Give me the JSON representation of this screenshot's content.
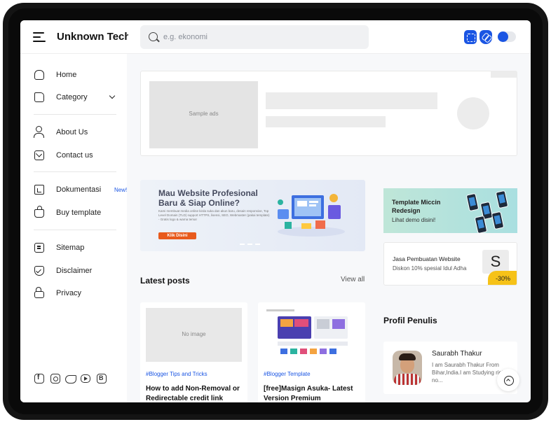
{
  "header": {
    "site_title": "Unknown Tech",
    "search_placeholder": "e.g. ekonomi"
  },
  "sidebar": {
    "items": [
      {
        "label": "Home",
        "icon": "home-icon"
      },
      {
        "label": "Category",
        "icon": "folder-icon"
      },
      {
        "label": "About Us",
        "icon": "user-icon"
      },
      {
        "label": "Contact us",
        "icon": "mail-icon"
      },
      {
        "label": "Dokumentasi",
        "icon": "document-icon",
        "badge": "New!"
      },
      {
        "label": "Buy template",
        "icon": "shopping-bag-icon"
      },
      {
        "label": "Sitemap",
        "icon": "sitemap-icon"
      },
      {
        "label": "Disclaimer",
        "icon": "shield-icon"
      },
      {
        "label": "Privacy",
        "icon": "lock-icon"
      }
    ],
    "social": [
      "facebook-icon",
      "instagram-icon",
      "twitter-icon",
      "youtube-icon",
      "blogger-icon"
    ]
  },
  "ad": {
    "placeholder": "Sample ads"
  },
  "banner": {
    "title": "Mau Website Profesional Baru & Siap Online?",
    "subtitle": "Kami membuat media online kirda suka dan akun baru, desain responsive, Top Level Domain (TLD) support HTTPS, lisensi, SEO, Webmaster (pakai template) - Gratis logo & warna tema!",
    "cta": "Klik Disini"
  },
  "promos": [
    {
      "title": "Template Miccin Redesign",
      "subtitle": "Lihat demo disini!"
    },
    {
      "title": "Jasa Pembuatan Website",
      "subtitle": "Diskon 10% spesial Idul Adha",
      "logo": "S",
      "discount": "-30%"
    }
  ],
  "latest": {
    "title": "Latest posts",
    "view_all": "View all",
    "posts": [
      {
        "thumb": "No image",
        "tag": "#Blogger Tips and Tricks",
        "title": "How to add Non-Removal or Redirectable credit link"
      },
      {
        "thumb": "",
        "tag": "#Blogger Template",
        "title": "[free]Masign Asuka- Latest Version Premium"
      }
    ]
  },
  "author": {
    "section_title": "Profil Penulis",
    "name": "Saurabh Thakur",
    "bio": "I am Saurabh Thakur From Bihar,India.I am Studying right no..."
  },
  "colors": {
    "accent": "#1a55e3",
    "cta": "#e85a1c",
    "discount": "#f6c218"
  }
}
